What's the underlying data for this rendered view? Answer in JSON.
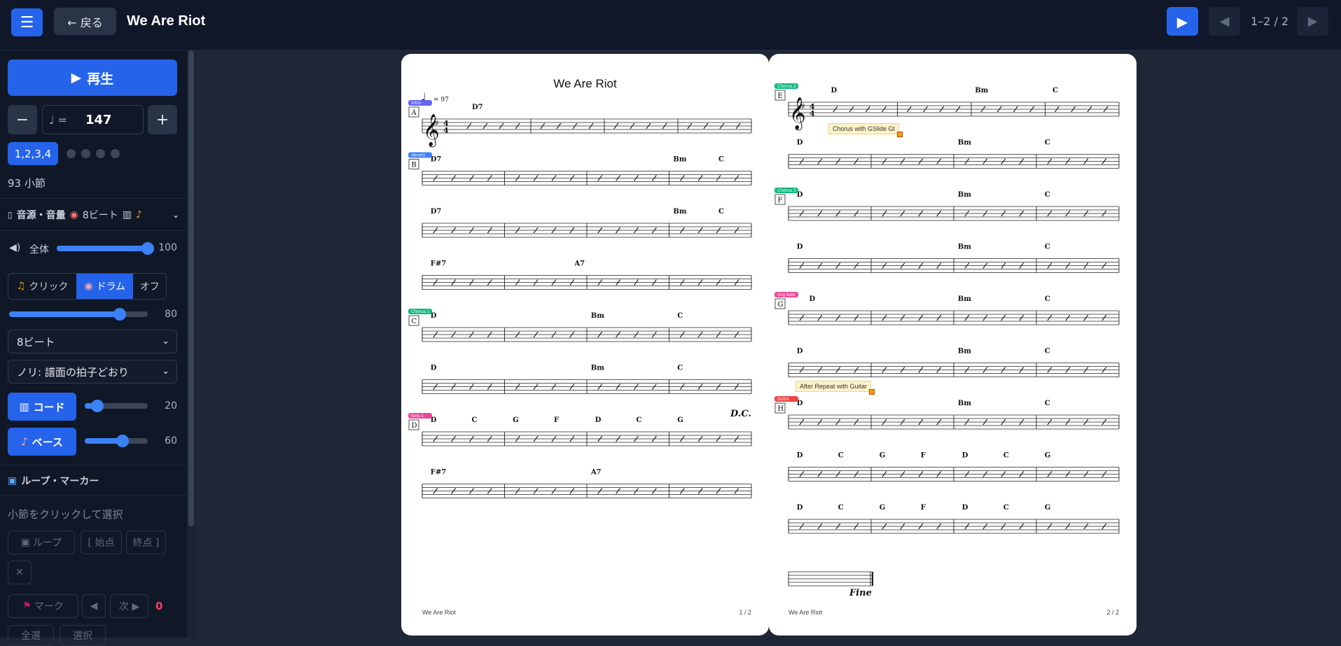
{
  "app": {
    "title": "We Are Riot",
    "menu_icon": "☰",
    "back_label": "← 戻る",
    "page_indicator": "1–2 / 2"
  },
  "transport": {
    "play_label": "再生",
    "tempo_note": "♩ =",
    "tempo": "147",
    "beat_label": "1,2,3,4",
    "measure_count": "93 小節"
  },
  "mixer": {
    "header": "音源・音量",
    "header_tags": [
      "8ビート"
    ],
    "master_label": "全体",
    "master_value": "100",
    "master_level": 100,
    "metro_options": [
      "クリック",
      "ドラム",
      "オフ"
    ],
    "metro_selected": "ドラム",
    "metro_value": "80",
    "metro_level": 80,
    "pattern_select": "8ビート",
    "feel_select": "ノリ: 譜面の拍子どおり",
    "chord_label": "コード",
    "chord_value": "20",
    "chord_level": 20,
    "bass_label": "ベース",
    "bass_value": "60",
    "bass_level": 60
  },
  "loop": {
    "header": "ループ・マーカー",
    "hint": "小節をクリックして選択",
    "loop_label": "ループ",
    "start_label": "[ 始点",
    "end_label": "終点 ]",
    "mark_label": "マーク",
    "next_label": "次 ▶",
    "marker_count": "0",
    "extra_left": "全選",
    "extra_right": "選択"
  },
  "sheet": {
    "title": "We Are Riot",
    "tempo_mark": "= 97",
    "footer_title": "We Are Riot",
    "page1_num": "1 / 2",
    "page2_num": "2 / 2",
    "dc": "D.C.",
    "fine": "Fine",
    "annotation1": "Chorus with GSlide Gt",
    "annotation2": "After Repeat with Guitar",
    "page1_systems": [
      {
        "rehearsal": "A",
        "tag": "Intro",
        "tag_color": "#6366f1",
        "chords": [
          {
            "m": 0,
            "p": 0.2,
            "c": "D7"
          }
        ]
      },
      {
        "rehearsal": "B",
        "tag": "Verse1",
        "tag_color": "#3b82f6",
        "chords": [
          {
            "m": 0,
            "p": 0.1,
            "c": "D7"
          },
          {
            "m": 3,
            "p": 0.05,
            "c": "Bm"
          },
          {
            "m": 3,
            "p": 0.6,
            "c": "C"
          }
        ]
      },
      {
        "rehearsal": "",
        "tag": "",
        "chords": [
          {
            "m": 0,
            "p": 0.1,
            "c": "D7"
          },
          {
            "m": 3,
            "p": 0.05,
            "c": "Bm"
          },
          {
            "m": 3,
            "p": 0.6,
            "c": "C"
          }
        ]
      },
      {
        "rehearsal": "",
        "tag": "",
        "chords": [
          {
            "m": 0,
            "p": 0.1,
            "c": "F#7"
          },
          {
            "m": 1,
            "p": 0.85,
            "c": "A7"
          }
        ]
      },
      {
        "rehearsal": "C",
        "tag": "Chorus.1",
        "tag_color": "#10b981",
        "chords": [
          {
            "m": 0,
            "p": 0.1,
            "c": "D"
          },
          {
            "m": 2,
            "p": 0.05,
            "c": "Bm"
          },
          {
            "m": 3,
            "p": 0.1,
            "c": "C"
          }
        ]
      },
      {
        "rehearsal": "",
        "tag": "",
        "chords": [
          {
            "m": 0,
            "p": 0.1,
            "c": "D"
          },
          {
            "m": 2,
            "p": 0.05,
            "c": "Bm"
          },
          {
            "m": 3,
            "p": 0.1,
            "c": "C"
          }
        ]
      },
      {
        "rehearsal": "D",
        "tag": "Solo.1",
        "tag_color": "#ec4899",
        "chords": [
          {
            "m": 0,
            "p": 0.1,
            "c": "D"
          },
          {
            "m": 0,
            "p": 0.6,
            "c": "C"
          },
          {
            "m": 1,
            "p": 0.1,
            "c": "G"
          },
          {
            "m": 1,
            "p": 0.6,
            "c": "F"
          },
          {
            "m": 2,
            "p": 0.1,
            "c": "D"
          },
          {
            "m": 2,
            "p": 0.6,
            "c": "C"
          },
          {
            "m": 3,
            "p": 0.1,
            "c": "G"
          }
        ]
      },
      {
        "rehearsal": "",
        "tag": "",
        "chords": [
          {
            "m": 0,
            "p": 0.1,
            "c": "F#7"
          },
          {
            "m": 2,
            "p": 0.05,
            "c": "A7"
          }
        ]
      }
    ],
    "page2_systems": [
      {
        "rehearsal": "E",
        "tag": "Chorus.2",
        "tag_color": "#10b981",
        "chords": [
          {
            "m": 0,
            "p": 0.1,
            "c": "D"
          },
          {
            "m": 2,
            "p": 0.05,
            "c": "Bm"
          },
          {
            "m": 3,
            "p": 0.1,
            "c": "C"
          }
        ]
      },
      {
        "rehearsal": "",
        "tag": "",
        "chords": [
          {
            "m": 0,
            "p": 0.1,
            "c": "D"
          },
          {
            "m": 2,
            "p": 0.05,
            "c": "Bm"
          },
          {
            "m": 3,
            "p": 0.1,
            "c": "C"
          }
        ]
      },
      {
        "rehearsal": "F",
        "tag": "Chorus.3",
        "tag_color": "#10b981",
        "chords": [
          {
            "m": 0,
            "p": 0.1,
            "c": "D"
          },
          {
            "m": 2,
            "p": 0.05,
            "c": "Bm"
          },
          {
            "m": 3,
            "p": 0.1,
            "c": "C"
          }
        ]
      },
      {
        "rehearsal": "",
        "tag": "",
        "chords": [
          {
            "m": 0,
            "p": 0.1,
            "c": "D"
          },
          {
            "m": 2,
            "p": 0.05,
            "c": "Bm"
          },
          {
            "m": 3,
            "p": 0.1,
            "c": "C"
          }
        ]
      },
      {
        "rehearsal": "G",
        "tag": "Org.Solo",
        "tag_color": "#ec4899",
        "chords": [
          {
            "m": 0,
            "p": 0.25,
            "c": "D"
          },
          {
            "m": 2,
            "p": 0.05,
            "c": "Bm"
          },
          {
            "m": 3,
            "p": 0.1,
            "c": "C"
          }
        ]
      },
      {
        "rehearsal": "",
        "tag": "",
        "chords": [
          {
            "m": 0,
            "p": 0.1,
            "c": "D"
          },
          {
            "m": 2,
            "p": 0.05,
            "c": "Bm"
          },
          {
            "m": 3,
            "p": 0.1,
            "c": "C"
          }
        ]
      },
      {
        "rehearsal": "H",
        "tag": "Outro",
        "tag_color": "#ef4444",
        "chords": [
          {
            "m": 0,
            "p": 0.1,
            "c": "D"
          },
          {
            "m": 2,
            "p": 0.05,
            "c": "Bm"
          },
          {
            "m": 3,
            "p": 0.1,
            "c": "C"
          }
        ]
      },
      {
        "rehearsal": "",
        "tag": "",
        "chords": [
          {
            "m": 0,
            "p": 0.1,
            "c": "D"
          },
          {
            "m": 0,
            "p": 0.6,
            "c": "C"
          },
          {
            "m": 1,
            "p": 0.1,
            "c": "G"
          },
          {
            "m": 1,
            "p": 0.6,
            "c": "F"
          },
          {
            "m": 2,
            "p": 0.1,
            "c": "D"
          },
          {
            "m": 2,
            "p": 0.6,
            "c": "C"
          },
          {
            "m": 3,
            "p": 0.1,
            "c": "G"
          }
        ]
      },
      {
        "rehearsal": "",
        "tag": "",
        "chords": [
          {
            "m": 0,
            "p": 0.1,
            "c": "D"
          },
          {
            "m": 0,
            "p": 0.6,
            "c": "C"
          },
          {
            "m": 1,
            "p": 0.1,
            "c": "G"
          },
          {
            "m": 1,
            "p": 0.6,
            "c": "F"
          },
          {
            "m": 2,
            "p": 0.1,
            "c": "D"
          },
          {
            "m": 2,
            "p": 0.6,
            "c": "C"
          },
          {
            "m": 3,
            "p": 0.1,
            "c": "G"
          }
        ]
      }
    ]
  }
}
